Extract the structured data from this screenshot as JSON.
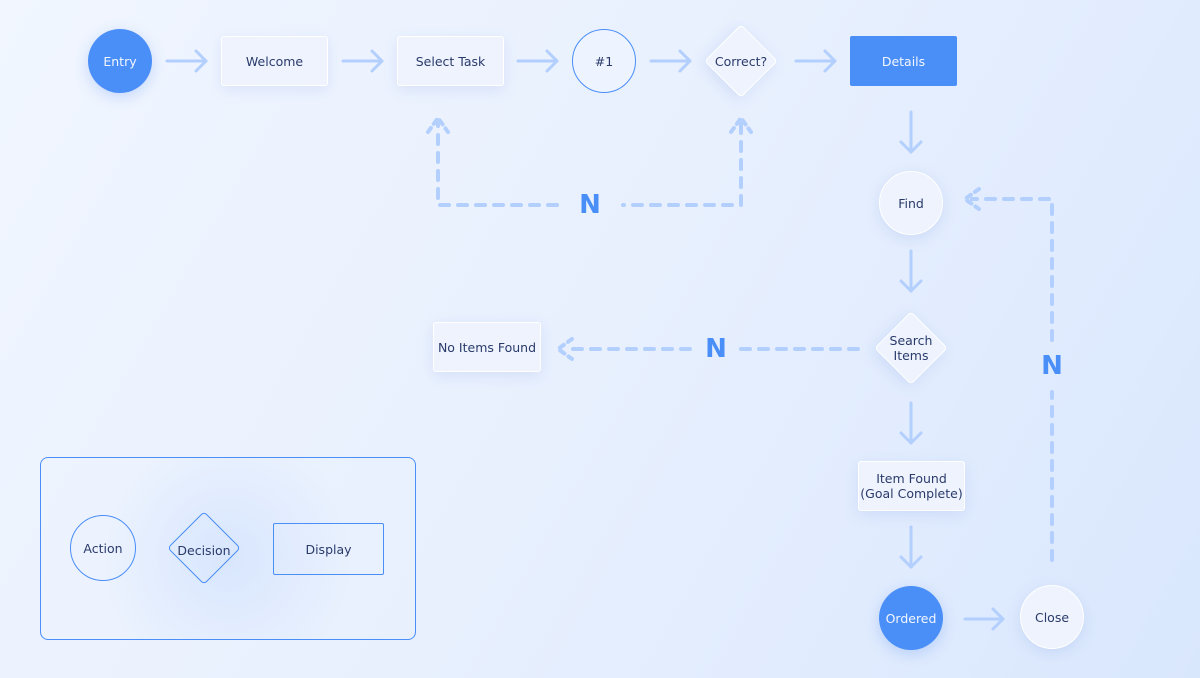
{
  "nodes": {
    "entry": "Entry",
    "welcome": "Welcome",
    "select_task": "Select Task",
    "step1": "#1",
    "correct": "Correct?",
    "details": "Details",
    "find": "Find",
    "search_items_1": "Search",
    "search_items_2": "Items",
    "no_items_found": "No Items Found",
    "item_found_1": "Item Found",
    "item_found_2": "(Goal Complete)",
    "ordered": "Ordered",
    "close": "Close"
  },
  "edge_labels": {
    "n1": "N",
    "n2": "N",
    "n3": "N"
  },
  "legend": {
    "action": "Action",
    "decision": "Decision",
    "display": "Display"
  },
  "colors": {
    "accent": "#4a8ef8",
    "arrow": "#b3cffd",
    "text": "#2a3b6b"
  }
}
